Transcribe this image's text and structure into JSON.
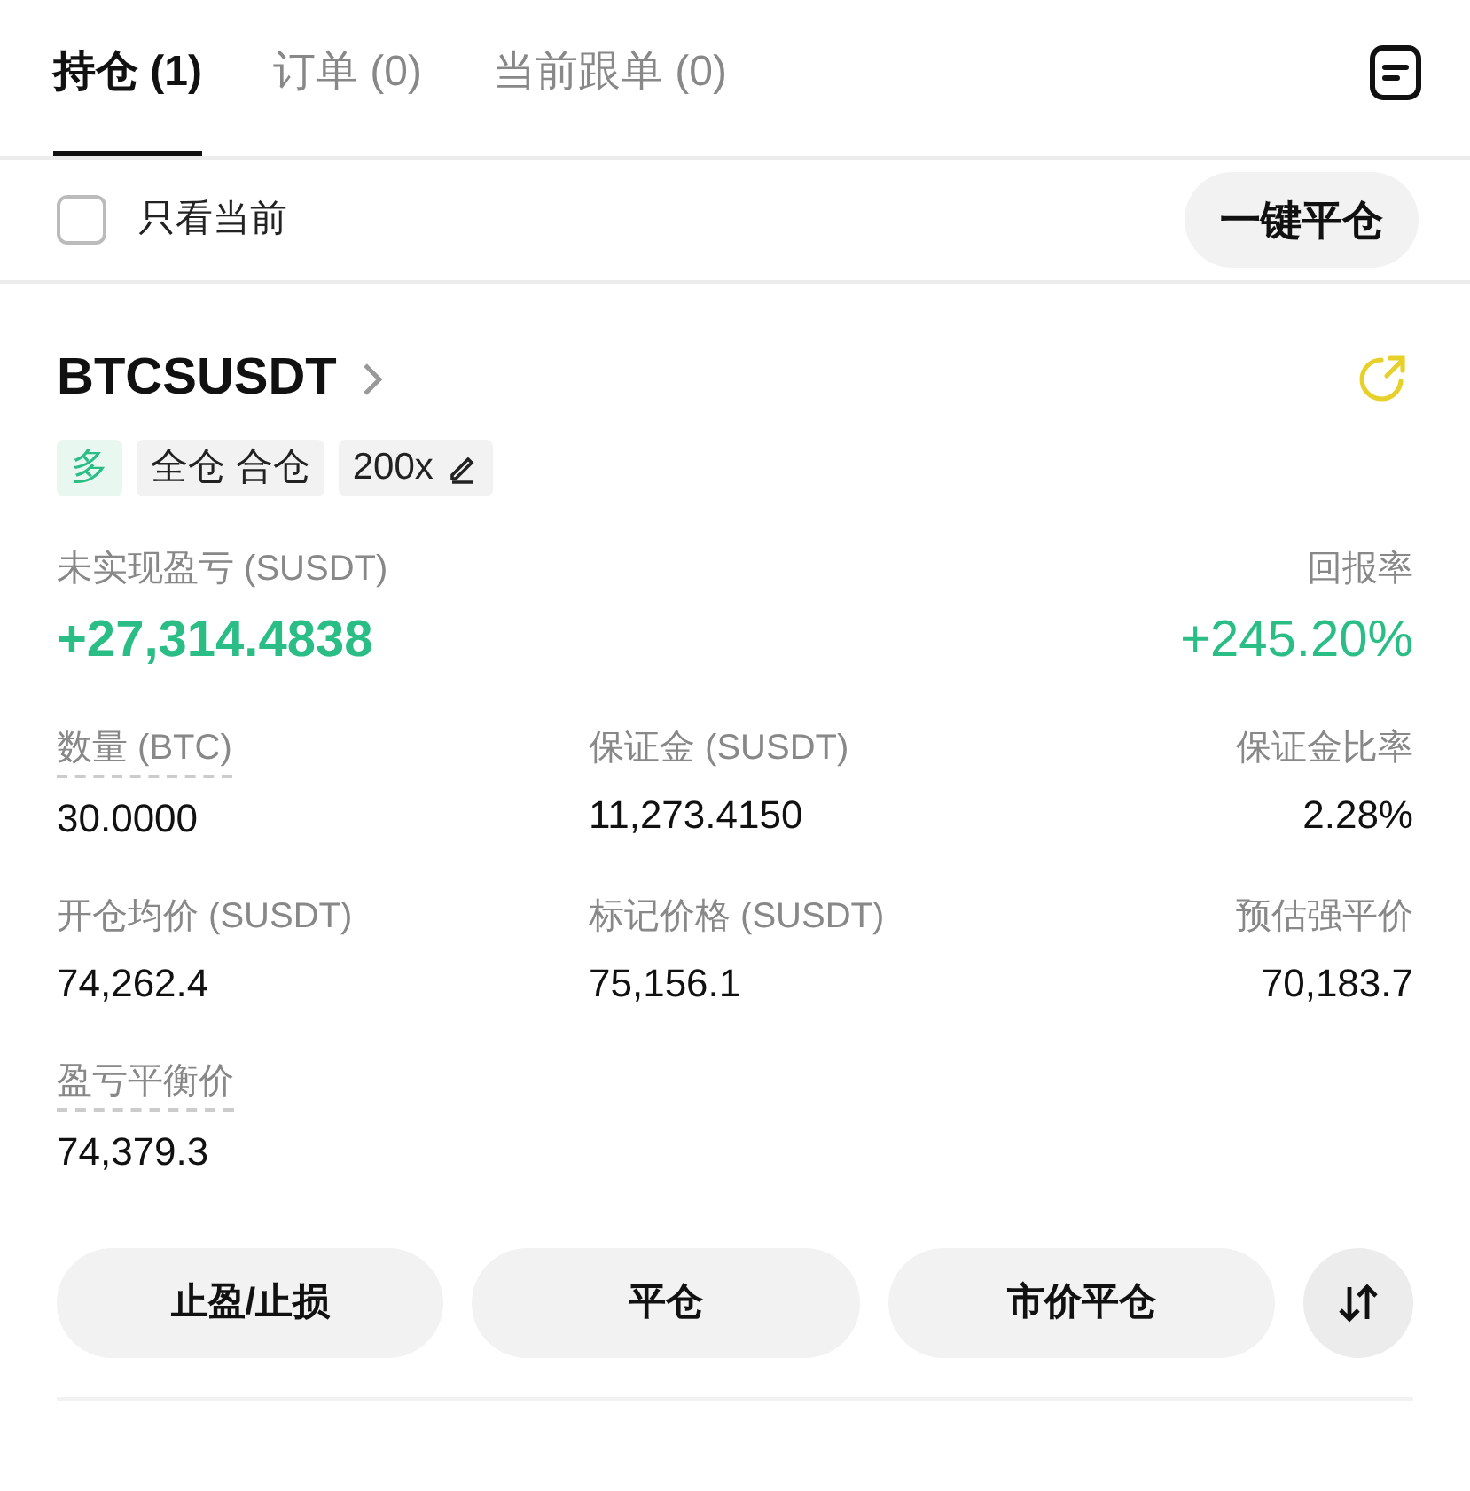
{
  "tabs": [
    {
      "label": "持仓 (1)",
      "selected": true
    },
    {
      "label": "订单 (0)",
      "selected": false
    },
    {
      "label": "当前跟单 (0)",
      "selected": false
    }
  ],
  "filter": {
    "label": "只看当前",
    "checked": false
  },
  "close_all_button": "一键平仓",
  "position": {
    "symbol": "BTCSUSDT",
    "tags": [
      {
        "label": "多",
        "kind": "side"
      },
      {
        "label": "全仓 合仓",
        "kind": "mode"
      },
      {
        "label": "200x",
        "kind": "leverage"
      }
    ],
    "pnl": {
      "label": "未实现盈亏 (SUSDT)",
      "value": "+27,314.4838"
    },
    "roe": {
      "label": "回报率",
      "value": "+245.20%"
    },
    "fields": [
      {
        "label": "数量 (BTC)",
        "value": "30.0000",
        "dashed": true
      },
      {
        "label": "保证金 (SUSDT)",
        "value": "11,273.4150",
        "dashed": false
      },
      {
        "label": "保证金比率",
        "value": "2.28%",
        "dashed": false
      },
      {
        "label": "开仓均价 (SUSDT)",
        "value": "74,262.4",
        "dashed": false
      },
      {
        "label": "标记价格 (SUSDT)",
        "value": "75,156.1",
        "dashed": false
      },
      {
        "label": "预估强平价",
        "value": "70,183.7",
        "dashed": false
      },
      {
        "label": "盈亏平衡价",
        "value": "74,379.3",
        "dashed": true
      }
    ],
    "buttons": [
      "止盈/止损",
      "平仓",
      "市价平仓"
    ]
  }
}
